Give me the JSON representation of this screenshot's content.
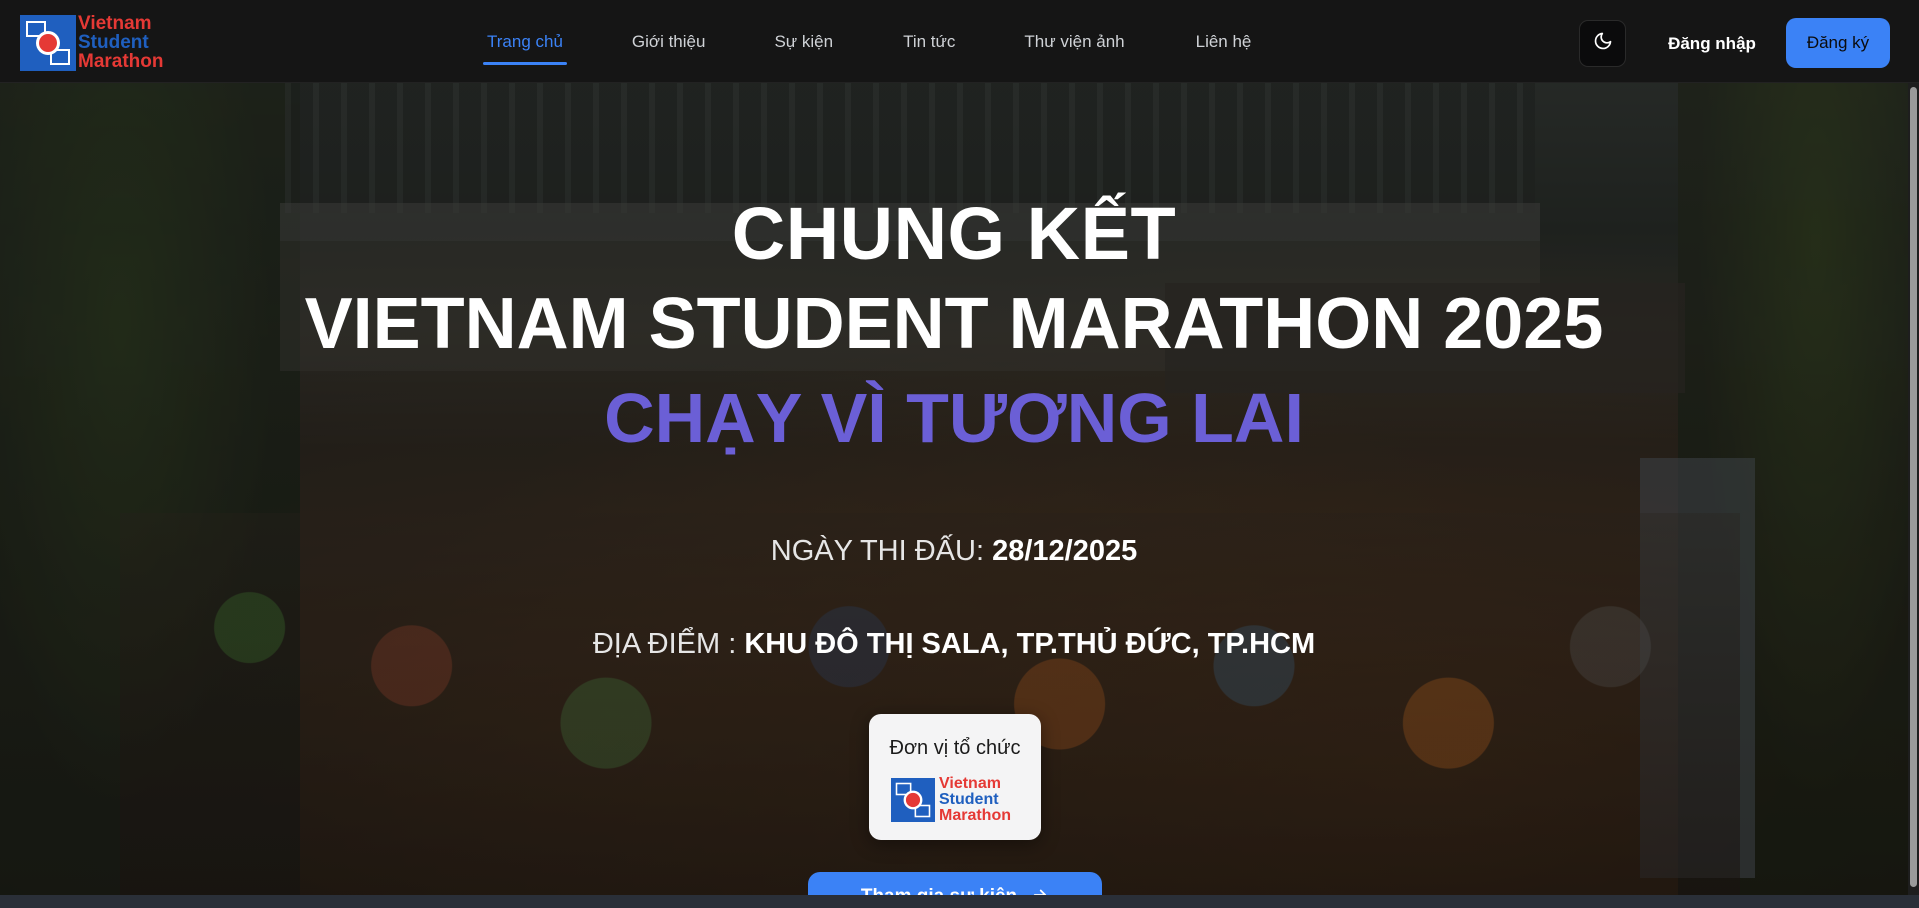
{
  "brand": {
    "line1": "Vietnam",
    "line2": "Student",
    "line3": "Marathon",
    "colors": {
      "red": "#e53935",
      "blue": "#1f5fbf"
    }
  },
  "nav": {
    "items": [
      {
        "label": "Trang chủ",
        "active": true
      },
      {
        "label": "Giới thiệu",
        "active": false
      },
      {
        "label": "Sự kiện",
        "active": false
      },
      {
        "label": "Tin tức",
        "active": false
      },
      {
        "label": "Thư viện ảnh",
        "active": false
      },
      {
        "label": "Liên hệ",
        "active": false
      }
    ]
  },
  "header": {
    "theme_icon": "moon-icon",
    "login_label": "Đăng nhập",
    "register_label": "Đăng ký"
  },
  "hero": {
    "title_line1": "CHUNG KẾT",
    "title_line2": "VIETNAM STUDENT MARATHON 2025",
    "slogan": "CHẠY VÌ TƯƠNG LAI",
    "date_label": "NGÀY THI ĐẤU:",
    "date_value": "28/12/2025",
    "place_label": "ĐỊA ĐIỂM :",
    "place_value": "KHU ĐÔ THỊ SALA, TP.THỦ ĐỨC, TP.HCM",
    "organizer_label": "Đơn vị tổ chức",
    "cta_label": "Tham gia sự kiện",
    "cta_icon": "arrow-right-icon",
    "slogan_color": "#6b5fd6",
    "accent_color": "#3b82f6"
  }
}
